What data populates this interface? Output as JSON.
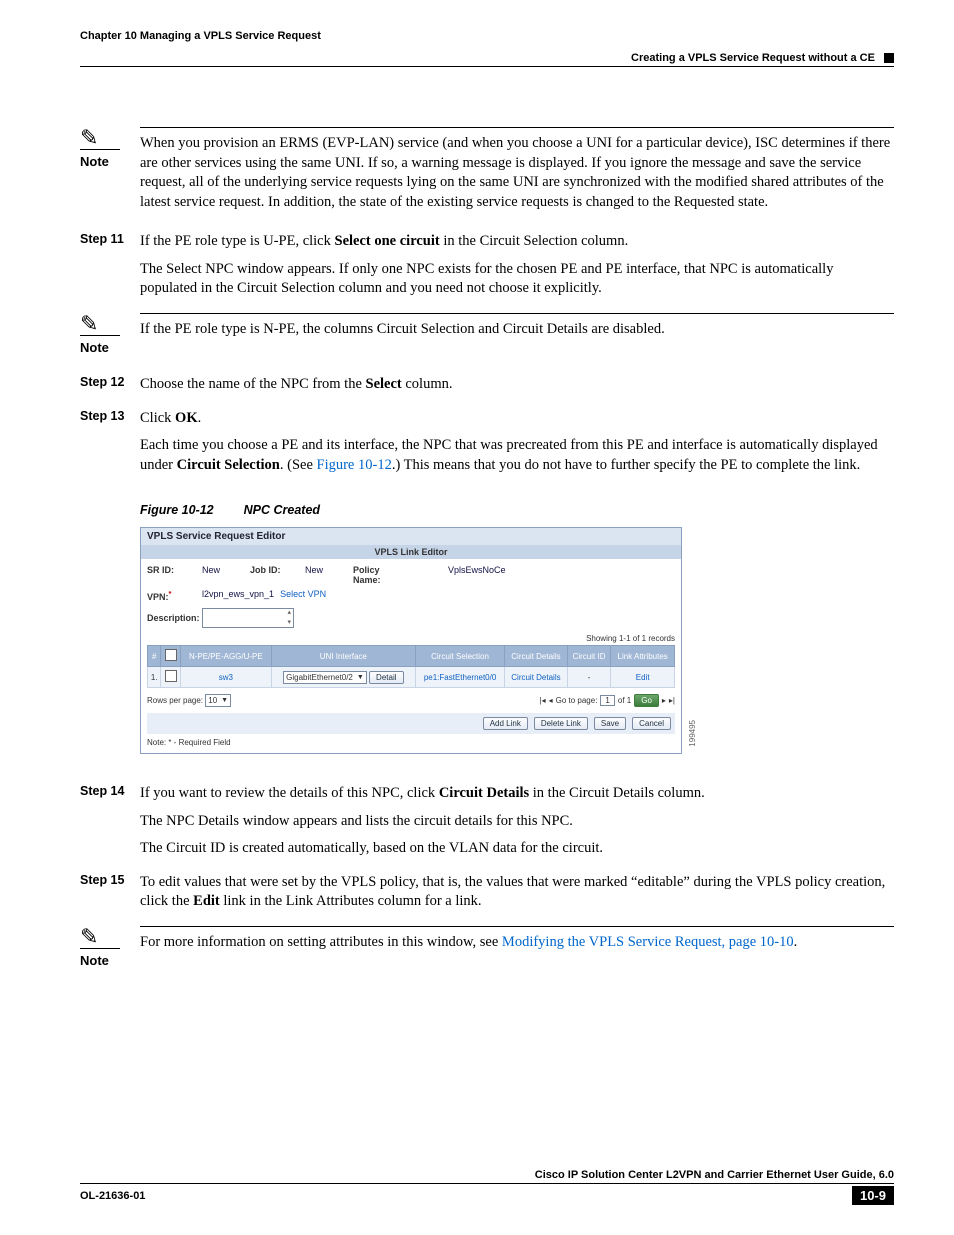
{
  "header": {
    "left": "Chapter 10      Managing a VPLS Service Request",
    "right": "Creating a VPLS Service Request without a CE"
  },
  "notes": {
    "label": "Note",
    "n1": "When you provision an ERMS (EVP-LAN) service (and when you choose a UNI for a particular device), ISC determines if there are other services using the same UNI. If so, a warning message is displayed. If you ignore the message and save the service request, all of the underlying service requests lying on the same UNI are synchronized with the modified shared attributes of the latest service request. In addition, the state of the existing service requests is changed to the Requested state.",
    "n2": "If the PE role type is N-PE, the columns Circuit Selection and Circuit Details are disabled.",
    "n3_a": "For more information on setting attributes in this window, see ",
    "n3_link": "Modifying the VPLS Service Request, page 10-10",
    "n3_b": "."
  },
  "steps": {
    "s11": {
      "label": "Step 11",
      "p1a": "If the PE role type is U-PE, click ",
      "p1b": "Select one circuit",
      "p1c": " in the Circuit Selection column.",
      "p2": "The Select NPC window appears. If only one NPC exists for the chosen PE and PE interface, that NPC is automatically populated in the Circuit Selection column and you need not choose it explicitly."
    },
    "s12": {
      "label": "Step 12",
      "a": "Choose the name of the NPC from the ",
      "b": "Select",
      "c": " column."
    },
    "s13": {
      "label": "Step 13",
      "a": "Click ",
      "b": "OK",
      "c": ".",
      "p2a": "Each time you choose a PE and its interface, the NPC that was precreated from this PE and interface is automatically displayed under ",
      "p2b": "Circuit Selection",
      "p2c": ". (See ",
      "p2link": "Figure 10-12",
      "p2d": ".) This means that you do not have to further specify the PE to complete the link."
    },
    "s14": {
      "label": "Step 14",
      "p1a": "If you want to review the details of this NPC, click ",
      "p1b": "Circuit Details",
      "p1c": " in the Circuit Details column.",
      "p2": "The NPC Details window appears and lists the circuit details for this NPC.",
      "p3": "The Circuit ID is created automatically, based on the VLAN data for the circuit."
    },
    "s15": {
      "label": "Step 15",
      "a": "To edit values that were set by the VPLS policy, that is, the values that were marked “editable” during the VPLS policy creation, click the ",
      "b": "Edit",
      "c": " link in the Link Attributes column for a link."
    }
  },
  "figure": {
    "caption_num": "Figure 10-12",
    "caption_title": "NPC Created",
    "title": "VPLS Service Request Editor",
    "linkeditor": "VPLS Link Editor",
    "labels": {
      "srid": "SR ID:",
      "jobid": "Job ID:",
      "policy": "Policy Name:",
      "vpn": "VPN:",
      "desc": "Description:",
      "selectvpn": "Select VPN",
      "records": "Showing 1-1 of 1 records",
      "rowsper": "Rows per page:",
      "goto": "Go to page:",
      "of1": "of 1",
      "req": "Note: * - Required Field"
    },
    "values": {
      "srid": "New",
      "jobid": "New",
      "policy": "VplsEwsNoCe",
      "vpn": "l2vpn_ews_vpn_1",
      "rows": "10",
      "page": "1"
    },
    "buttons": {
      "detail": "Detail",
      "addlink": "Add Link",
      "dellink": "Delete Link",
      "save": "Save",
      "cancel": "Cancel",
      "go": "Go"
    },
    "cols": {
      "num": "#",
      "pe": "N-PE/PE-AGG/U-PE",
      "uni": "UNI Interface",
      "circsel": "Circuit Selection",
      "circdet": "Circuit Details",
      "circid": "Circuit ID",
      "linkattr": "Link Attributes"
    },
    "row": {
      "n": "1.",
      "pe": "sw3",
      "uni": "GigabitEthernet0/2",
      "circsel": "pe1:FastEthernet0/0",
      "circdet": "Circuit Details",
      "circid": "-",
      "linkattr": "Edit"
    },
    "sideid": "199495"
  },
  "footer": {
    "guide": "Cisco IP Solution Center L2VPN and Carrier Ethernet User Guide, 6.0",
    "docid": "OL-21636-01",
    "pagenum": "10-9"
  }
}
